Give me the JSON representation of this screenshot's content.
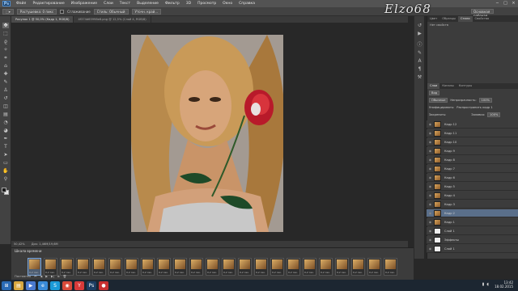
{
  "app": {
    "logo": "Ps",
    "menu": [
      "Файл",
      "Редактирование",
      "Изображение",
      "Слои",
      "Текст",
      "Выделение",
      "Фильтр",
      "3D",
      "Просмотр",
      "Окно",
      "Справка"
    ],
    "window_controls": [
      "−",
      "□",
      "×"
    ],
    "watermark": "Elzo68"
  },
  "options_bar": {
    "items": [
      {
        "type": "button",
        "label": "Растушевка: 0 пикс"
      },
      {
        "type": "check",
        "label": "Сглаживание"
      },
      {
        "type": "button",
        "label": "Стиль: Обычный"
      },
      {
        "type": "button",
        "label": "Уточн. край..."
      }
    ],
    "workspace": "Основная рабочая среда"
  },
  "tabs": [
    {
      "label": "Рисунок 1 @ 50,0% (Кадр 1, RGB/8)",
      "active": true
    },
    {
      "label": "4f374d65998e8.png @ 12,5% (Слой 4, RGB/8)",
      "active": false
    }
  ],
  "toolbar": {
    "tools": [
      {
        "name": "move-tool",
        "glyph": "✥"
      },
      {
        "name": "marquee-tool",
        "glyph": "⬚"
      },
      {
        "name": "lasso-tool",
        "glyph": "ϱ"
      },
      {
        "name": "magic-wand-tool",
        "glyph": "✧"
      },
      {
        "name": "crop-tool",
        "glyph": "⌗"
      },
      {
        "name": "eyedropper-tool",
        "glyph": "⌂"
      },
      {
        "name": "healing-tool",
        "glyph": "✚"
      },
      {
        "name": "brush-tool",
        "glyph": "✎"
      },
      {
        "name": "stamp-tool",
        "glyph": "♙"
      },
      {
        "name": "history-brush-tool",
        "glyph": "↺"
      },
      {
        "name": "eraser-tool",
        "glyph": "◫"
      },
      {
        "name": "gradient-tool",
        "glyph": "▤"
      },
      {
        "name": "blur-tool",
        "glyph": "◔"
      },
      {
        "name": "dodge-tool",
        "glyph": "◕"
      },
      {
        "name": "pen-tool",
        "glyph": "✒"
      },
      {
        "name": "type-tool",
        "glyph": "T"
      },
      {
        "name": "path-select-tool",
        "glyph": "➤"
      },
      {
        "name": "shape-tool",
        "glyph": "▭"
      },
      {
        "name": "hand-tool",
        "glyph": "✋"
      },
      {
        "name": "zoom-tool",
        "glyph": "⚲"
      }
    ]
  },
  "swatches_panel": {
    "tabs": [
      "Цвет",
      "Образцы",
      "Стили",
      "Свойства"
    ],
    "label": "Нет свойств"
  },
  "layers_panel": {
    "tabs": [
      "Слои",
      "Каналы",
      "Контуры"
    ],
    "kind": "Вид",
    "blend_mode": "Обычные",
    "opacity_label": "Непрозрачность:",
    "opacity": "100%",
    "unify_label": "Унифицировать:",
    "propagate_label": "Распространить кадр 1",
    "lock_label": "Закрепить:",
    "fill_label": "Заливка:",
    "fill": "100%",
    "layers": [
      {
        "name": "Кадр 12",
        "selected": false,
        "fx": false
      },
      {
        "name": "Кадр 11",
        "selected": false,
        "fx": false
      },
      {
        "name": "Кадр 10",
        "selected": false,
        "fx": false
      },
      {
        "name": "Кадр 9",
        "selected": false,
        "fx": false
      },
      {
        "name": "Кадр 8",
        "selected": false,
        "fx": false
      },
      {
        "name": "Кадр 7",
        "selected": false,
        "fx": false
      },
      {
        "name": "Кадр 6",
        "selected": false,
        "fx": false
      },
      {
        "name": "Кадр 5",
        "selected": false,
        "fx": false
      },
      {
        "name": "Кадр 4",
        "selected": false,
        "fx": false
      },
      {
        "name": "Кадр 3",
        "selected": false,
        "fx": false
      },
      {
        "name": "Кадр 2",
        "selected": true,
        "fx": false
      },
      {
        "name": "Кадр 1",
        "selected": false,
        "fx": false
      },
      {
        "name": "Слой 1",
        "selected": false,
        "fx": true
      },
      {
        "name": "Эффекты",
        "selected": false,
        "fx": true
      },
      {
        "name": "Слой 1",
        "selected": false,
        "fx": true
      }
    ]
  },
  "status": {
    "zoom": "50,42%",
    "doc": "Док: 1,46M/19,6M"
  },
  "timeline": {
    "title": "Шкала времени",
    "frames": [
      {
        "n": "1",
        "delay": "0,2 сек.",
        "sel": true
      },
      {
        "n": "2",
        "delay": "0,2 сек.",
        "sel": false
      },
      {
        "n": "3",
        "delay": "0,2 сек.",
        "sel": false
      },
      {
        "n": "4",
        "delay": "0,2 сек.",
        "sel": false
      },
      {
        "n": "5",
        "delay": "0,2 сек.",
        "sel": false
      },
      {
        "n": "6",
        "delay": "0,2 сек.",
        "sel": false
      },
      {
        "n": "7",
        "delay": "0,2 сек.",
        "sel": false
      },
      {
        "n": "8",
        "delay": "0,2 сек.",
        "sel": false
      },
      {
        "n": "9",
        "delay": "0,2 сек.",
        "sel": false
      },
      {
        "n": "10",
        "delay": "0,2 сек.",
        "sel": false
      },
      {
        "n": "11",
        "delay": "0,2 сек.",
        "sel": false
      },
      {
        "n": "12",
        "delay": "0,2 сек.",
        "sel": false
      },
      {
        "n": "13",
        "delay": "0,2 сек.",
        "sel": false
      },
      {
        "n": "14",
        "delay": "0,2 сек.",
        "sel": false
      },
      {
        "n": "15",
        "delay": "0,2 сек.",
        "sel": false
      },
      {
        "n": "16",
        "delay": "0,2 сек.",
        "sel": false
      },
      {
        "n": "17",
        "delay": "0,2 сек.",
        "sel": false
      },
      {
        "n": "18",
        "delay": "0,2 сек.",
        "sel": false
      },
      {
        "n": "19",
        "delay": "0,2 сек.",
        "sel": false
      },
      {
        "n": "20",
        "delay": "0,2 сек.",
        "sel": false
      },
      {
        "n": "21",
        "delay": "0,2 сек.",
        "sel": false
      },
      {
        "n": "22",
        "delay": "0,2 сек.",
        "sel": false
      },
      {
        "n": "23",
        "delay": "0,2 сек.",
        "sel": false
      }
    ],
    "loop": "Постоянно",
    "controls": [
      "⏮",
      "◀",
      "▶",
      "▶|",
      "⧉",
      "🗑"
    ]
  },
  "taskbar": {
    "apps": [
      {
        "name": "start",
        "glyph": "⊞",
        "color": "#2a6bb6"
      },
      {
        "name": "explorer",
        "glyph": "▤",
        "color": "#d8a840"
      },
      {
        "name": "media",
        "glyph": "▶",
        "color": "#4a7ad0"
      },
      {
        "name": "ie",
        "glyph": "e",
        "color": "#3a8ad8"
      },
      {
        "name": "skype",
        "glyph": "S",
        "color": "#1a9ad8"
      },
      {
        "name": "chrome",
        "glyph": "◉",
        "color": "#d84a3a"
      },
      {
        "name": "yandex",
        "glyph": "Y",
        "color": "#d83a3a"
      },
      {
        "name": "photoshop",
        "glyph": "Ps",
        "color": "#1c3d63"
      },
      {
        "name": "recorder",
        "glyph": "●",
        "color": "#c83030"
      }
    ],
    "time": "13:42",
    "date": "18.02.2015"
  }
}
